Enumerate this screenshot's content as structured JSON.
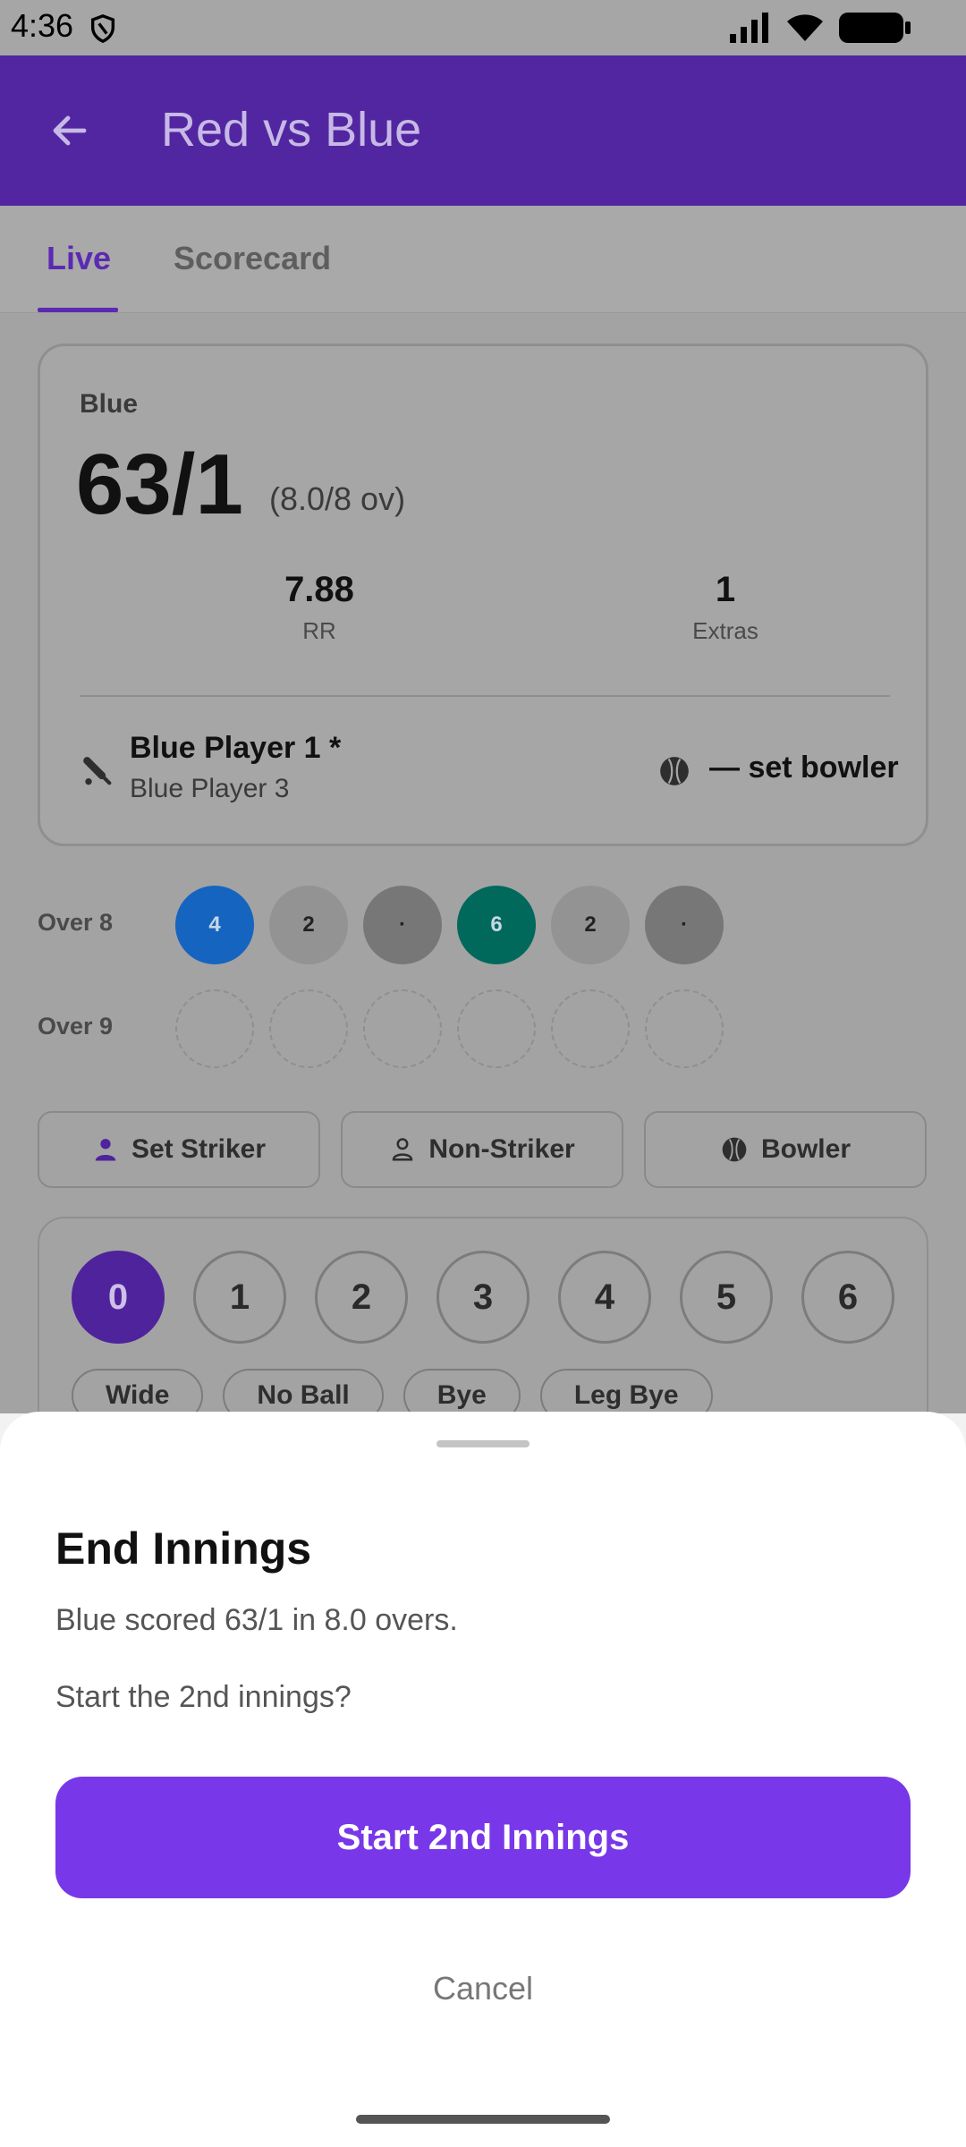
{
  "status_bar": {
    "time": "4:36"
  },
  "app_bar": {
    "title": "Red vs Blue"
  },
  "tabs": [
    {
      "label": "Live",
      "active": true
    },
    {
      "label": "Scorecard",
      "active": false
    }
  ],
  "score_card": {
    "team": "Blue",
    "score": "63/1",
    "overs": "(8.0/8 ov)",
    "stats": [
      {
        "value": "7.88",
        "label": "RR"
      },
      {
        "value": "1",
        "label": "Extras"
      }
    ],
    "striker": "Blue Player 1 *",
    "non_striker": "Blue Player 3",
    "bowler": "— set bowler"
  },
  "overs": [
    {
      "label": "Over 8",
      "balls": [
        {
          "text": "4",
          "color": "#1565c0"
        },
        {
          "text": "2",
          "color": "#939393"
        },
        {
          "text": "·",
          "color": "#777777"
        },
        {
          "text": "6",
          "color": "#00695c"
        },
        {
          "text": "2",
          "color": "#939393"
        },
        {
          "text": "·",
          "color": "#777777"
        }
      ]
    },
    {
      "label": "Over 9",
      "balls": []
    }
  ],
  "roles": {
    "striker": "Set Striker",
    "non_striker": "Non-Striker",
    "bowler": "Bowler"
  },
  "runs": [
    "0",
    "1",
    "2",
    "3",
    "4",
    "5",
    "6"
  ],
  "selected_run": "0",
  "extras": [
    "Wide",
    "No Ball",
    "Bye",
    "Leg Bye"
  ],
  "sheet": {
    "title": "End Innings",
    "line1": "Blue scored 63/1 in 8.0 overs.",
    "line2": "Start the 2nd innings?",
    "primary": "Start 2nd Innings",
    "cancel": "Cancel"
  },
  "colors": {
    "primary": "#7837e8",
    "app_bar": "#5226a0"
  }
}
